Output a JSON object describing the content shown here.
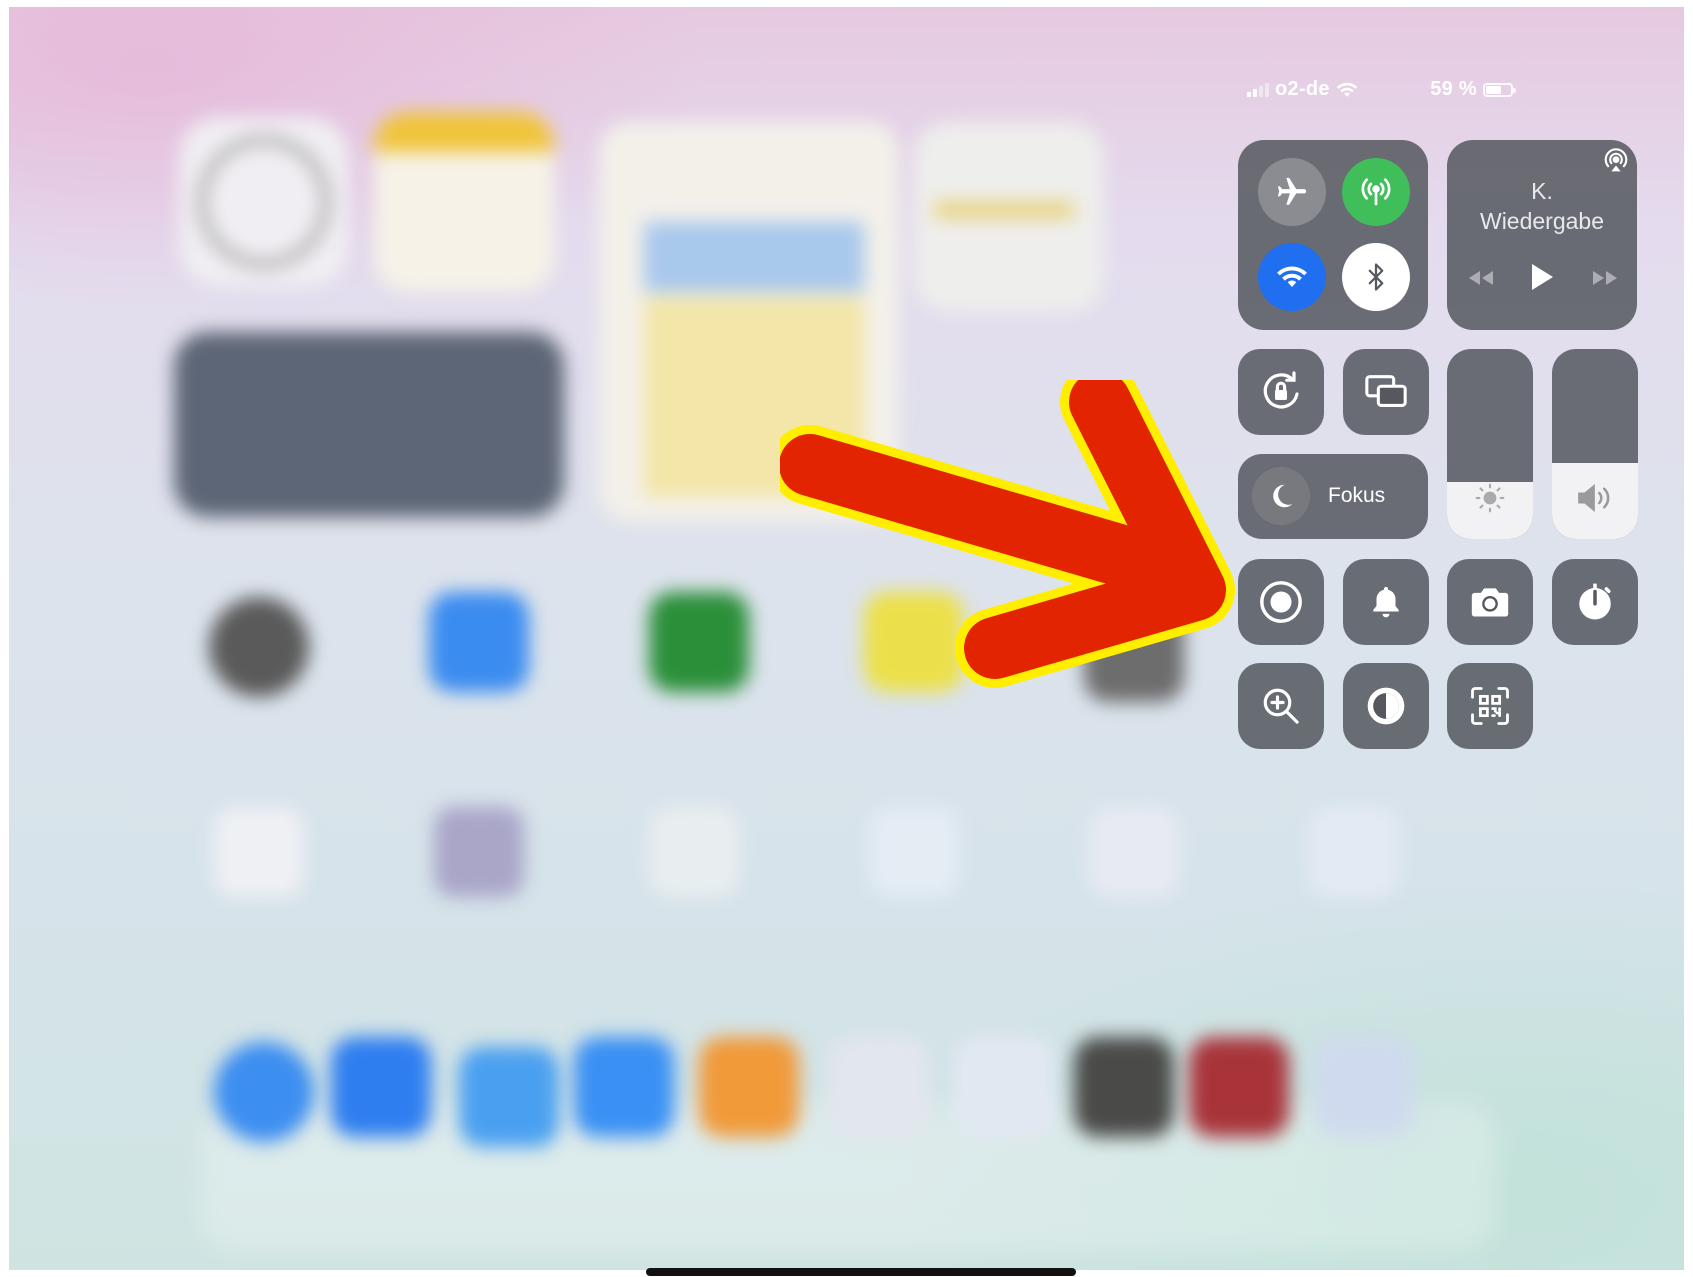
{
  "status_bar": {
    "carrier": "o2-de",
    "battery_percent": "59 %",
    "battery_level": 0.59,
    "signal_bars": 2,
    "signal_bars_total": 4
  },
  "control_center": {
    "connectivity": {
      "airplane_mode": false,
      "cellular_data": true,
      "wifi": true,
      "bluetooth": true
    },
    "now_playing": {
      "title_line1": "K.",
      "title_line2": "Wiedergabe"
    },
    "focus": {
      "label": "Fokus"
    },
    "brightness_level": 0.3,
    "volume_level": 0.4
  },
  "annotation": {
    "arrow_color": "#e22500",
    "arrow_outline": "#ffee00"
  },
  "colors": {
    "tile_bg": "#55585f",
    "cellular_green": "#3fbe5a",
    "wifi_blue": "#1f6ff0",
    "bluetooth_white": "#ffffff"
  },
  "icons": {
    "airplane": "airplane-icon",
    "cellular": "cellular-antenna-icon",
    "wifi": "wifi-icon",
    "bluetooth": "bluetooth-icon",
    "airplay": "airplay-icon",
    "rotation_lock": "rotation-lock-icon",
    "screen_mirroring": "screen-mirroring-icon",
    "focus": "moon-icon",
    "screen_recording": "screen-record-icon",
    "silent_mode": "bell-icon",
    "camera": "camera-icon",
    "timer": "timer-icon",
    "magnifier": "magnifier-icon",
    "dark_mode": "dark-mode-icon",
    "code_scanner": "qr-code-scanner-icon"
  }
}
